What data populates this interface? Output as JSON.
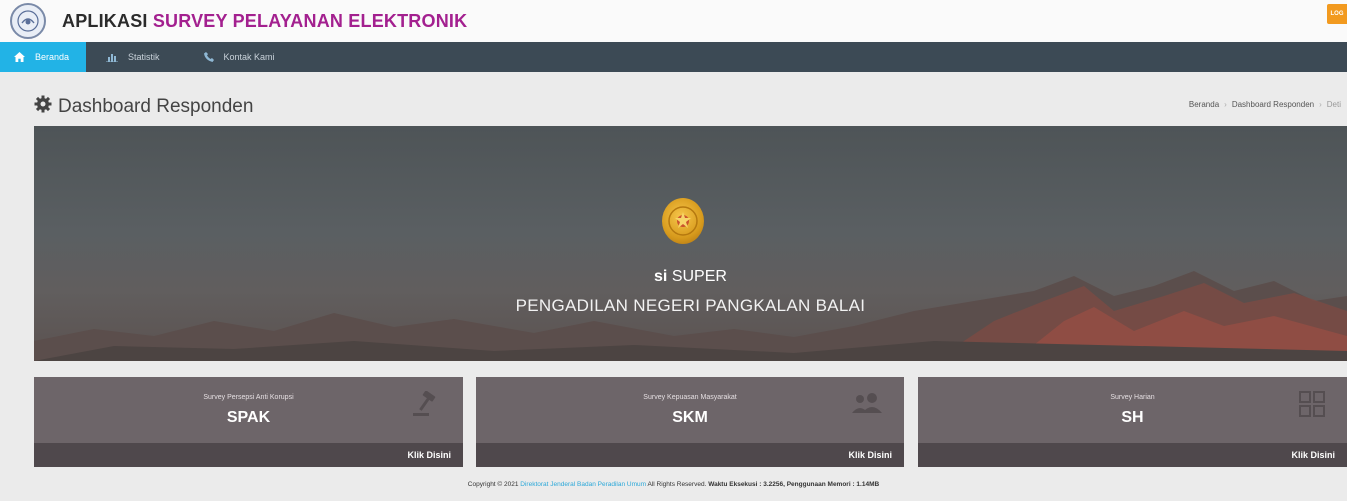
{
  "header": {
    "title_part1": "APLIKASI",
    "title_part2": "SURVEY PELAYANAN ELEKTRONIK",
    "logout_label": "LOG",
    "accent": "#a3208f"
  },
  "nav": {
    "items": [
      {
        "label": "Beranda",
        "icon": "home-icon"
      },
      {
        "label": "Statistik",
        "icon": "chart-icon"
      },
      {
        "label": "Kontak Kami",
        "icon": "phone-icon"
      }
    ],
    "active_color": "#22b3e6"
  },
  "page": {
    "title": "Dashboard Responden",
    "breadcrumb": [
      "Beranda",
      "Dashboard Responden",
      "Deti"
    ]
  },
  "hero": {
    "line1_bold": "si",
    "line1_rest": "SUPER",
    "line2": "PENGADILAN NEGERI PANGKALAN BALAI"
  },
  "cards": [
    {
      "subtitle": "Survey Persepsi Anti Korupsi",
      "title": "SPAK",
      "action": "Klik Disini",
      "icon": "gavel-icon"
    },
    {
      "subtitle": "Survey Kepuasan Masyarakat",
      "title": "SKM",
      "action": "Klik Disini",
      "icon": "users-icon"
    },
    {
      "subtitle": "Survey Harian",
      "title": "SH",
      "action": "Klik Disini",
      "icon": "grid-icon"
    }
  ],
  "footer": {
    "prefix": "Copyright © 2021",
    "link": "Direktorat Jenderal Badan Peradilan Umum",
    "middle": "All Rights Reserved.",
    "exec_label": "Waktu Eksekusi : 3.2256,",
    "mem_label": "Penggunaan Memori : 1.14MB"
  }
}
